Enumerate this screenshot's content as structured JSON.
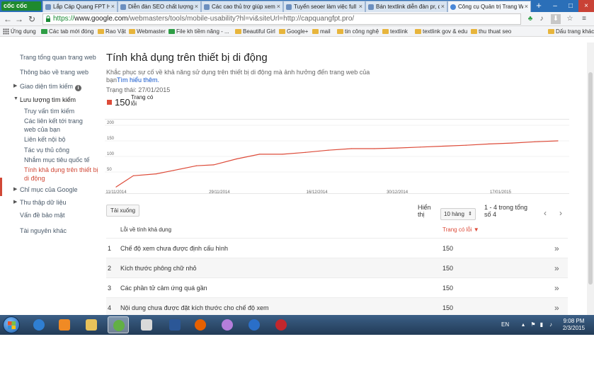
{
  "browser": {
    "logo": "cốc cốc",
    "tabs": [
      {
        "label": "Lắp Cáp Quang FPT Hà Nội",
        "active": false
      },
      {
        "label": "Diễn đàn SEO chất lượng",
        "active": false
      },
      {
        "label": "Các cao thủ trợ giúp xem",
        "active": false
      },
      {
        "label": "Tuyển seoer làm việc full t",
        "active": false
      },
      {
        "label": "Bán textlink diễn đàn pr, di",
        "active": false
      },
      {
        "label": "Công cụ Quản trị Trang W",
        "active": true
      }
    ],
    "new_tab": "+",
    "url_scheme": "https://",
    "url_host": "www.google.com",
    "url_path": "/webmasters/tools/mobile-usability?hl=vi&siteUrl=http://capquangfpt.pro/",
    "bookmarks": [
      {
        "label": "Ứng dụng",
        "icon": "apps-icon"
      },
      {
        "label": "Các tab mới đóng",
        "icon": "history-icon"
      },
      {
        "label": "Rao Vặt",
        "icon": "folder-icon"
      },
      {
        "label": "Webmaster",
        "icon": "folder-icon"
      },
      {
        "label": "File kh tiềm năng - ...",
        "icon": "sheet-icon"
      },
      {
        "label": "Beautiful Girl",
        "icon": "folder-icon"
      },
      {
        "label": "Google+",
        "icon": "folder-icon"
      },
      {
        "label": "mail",
        "icon": "folder-icon"
      },
      {
        "label": "tin công nghệ",
        "icon": "folder-icon"
      },
      {
        "label": "textlink",
        "icon": "folder-icon"
      },
      {
        "label": "textlink gov & edu",
        "icon": "folder-icon"
      },
      {
        "label": "thu thuat seo",
        "icon": "folder-icon"
      },
      {
        "label": "Dấu trang khác",
        "icon": "folder-icon"
      }
    ]
  },
  "sidebar": {
    "items": [
      {
        "label": "Trang tổng quan trang web"
      },
      {
        "label": "Thông báo về trang web"
      },
      {
        "label": "Giao diện tìm kiếm"
      },
      {
        "label": "Lưu lượng tìm kiếm"
      },
      {
        "label": "Truy vấn tìm kiếm"
      },
      {
        "label": "Các liên kết tới trang web của bạn"
      },
      {
        "label": "Liên kết nội bộ"
      },
      {
        "label": "Tác vụ thủ công"
      },
      {
        "label": "Nhắm mục tiêu quốc tế"
      },
      {
        "label": "Tính khả dụng trên thiết bị di động"
      },
      {
        "label": "Chỉ mục của Google"
      },
      {
        "label": "Thu thập dữ liệu"
      },
      {
        "label": "Vấn đề bảo mật"
      },
      {
        "label": "Tài nguyên khác"
      }
    ]
  },
  "main": {
    "title": "Tính khả dụng trên thiết bị di động",
    "description": "Khắc phục sự cố về khả năng sử dụng trên thiết bị di động mà ảnh hưởng đến trang web của bạn",
    "learn_more": "Tìm hiểu thêm.",
    "status": "Trạng thái: 27/01/2015",
    "legend_count": "150",
    "legend_label": "Trang có lỗi",
    "download": "Tải xuống",
    "show_label": "Hiển thị",
    "rows_select": "10 hàng",
    "pager": "1 - 4 trong tổng số 4",
    "col_issue": "Lỗi về tính khả dụng",
    "col_pages": "Trang có lỗi ▼",
    "rows": [
      {
        "idx": "1",
        "label": "Chế độ xem chưa được định cấu hình",
        "value": "150"
      },
      {
        "idx": "2",
        "label": "Kích thước phông chữ nhỏ",
        "value": "150"
      },
      {
        "idx": "3",
        "label": "Các phần tử cảm ứng quá gần",
        "value": "150"
      },
      {
        "idx": "4",
        "label": "Nội dung chưa được đặt kích thước cho chế độ xem",
        "value": "150"
      }
    ]
  },
  "chart_data": {
    "type": "line",
    "series": [
      {
        "name": "Trang có lỗi",
        "color": "#dd4b39",
        "x": [
          "11/11/2014",
          "14/11/2014",
          "18/11/2014",
          "21/11/2014",
          "25/11/2014",
          "28/11/2014",
          "02/12/2014",
          "06/12/2014",
          "10/12/2014",
          "14/12/2014",
          "18/12/2014",
          "22/12/2014",
          "26/12/2014",
          "30/12/2014",
          "03/01/2015",
          "07/01/2015",
          "11/01/2015",
          "15/01/2015",
          "19/01/2015",
          "23/01/2015",
          "27/01/2015"
        ],
        "values": [
          2,
          38,
          44,
          55,
          70,
          73,
          92,
          107,
          107,
          113,
          120,
          125,
          125,
          127,
          130,
          133,
          136,
          140,
          143,
          147,
          150
        ]
      }
    ],
    "x_tick_labels": [
      "11/11/2014",
      "29/11/2014",
      "16/12/2014",
      "30/12/2014",
      "17/01/2015"
    ],
    "y_ticks": [
      50,
      100,
      150,
      200
    ],
    "ylim": [
      0,
      200
    ],
    "grid": true,
    "colors": {
      "line": "#dd4b39",
      "grid": "#e5e5e5"
    }
  },
  "taskbar": {
    "apps": [
      "internet-explorer-icon",
      "media-player-icon",
      "file-explorer-icon",
      "coccoc-browser-icon",
      "network-icon",
      "word-icon",
      "firefox-icon",
      "messenger-icon",
      "ccleaner-icon",
      "game-icon"
    ],
    "lang": "EN",
    "time": "9:08 PM",
    "date": "2/3/2015"
  }
}
